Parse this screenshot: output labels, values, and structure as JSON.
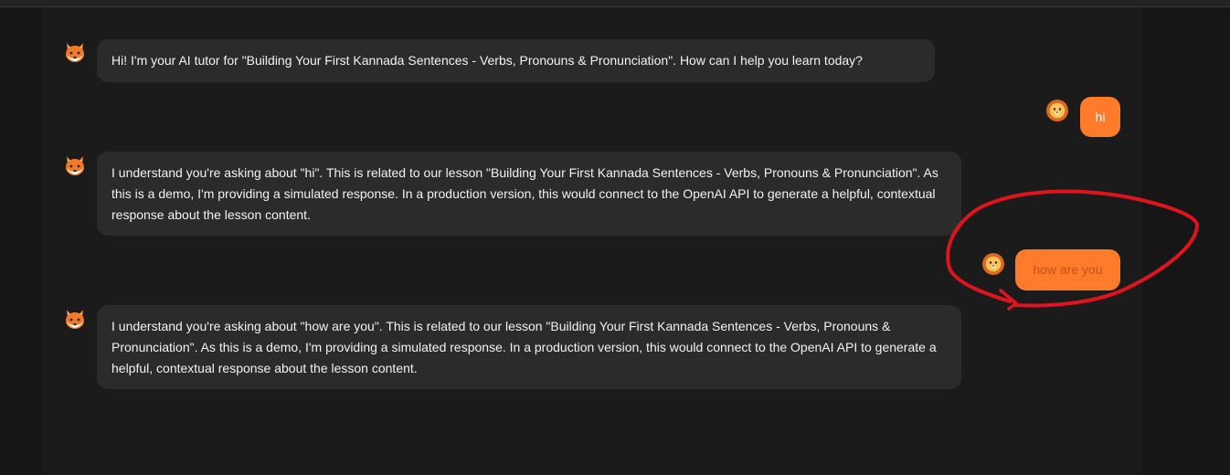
{
  "messages": [
    {
      "role": "assistant",
      "avatar_icon": "fox-icon",
      "text": "Hi! I'm your AI tutor for \"Building Your First Kannada Sentences - Verbs, Pronouns & Pronunciation\". How can I help you learn today?"
    },
    {
      "role": "user",
      "avatar_icon": "lion-icon",
      "text": "hi"
    },
    {
      "role": "assistant",
      "avatar_icon": "fox-icon",
      "text": "I understand you're asking about \"hi\". This is related to our lesson \"Building Your First Kannada Sentences - Verbs, Pronouns & Pronunciation\". As this is a demo, I'm providing a simulated response. In a production version, this would connect to the OpenAI API to generate a helpful, contextual response about the lesson content."
    },
    {
      "role": "user",
      "avatar_icon": "lion-icon",
      "text": "how are you"
    },
    {
      "role": "assistant",
      "avatar_icon": "fox-icon",
      "text": "I understand you're asking about \"how are you\". This is related to our lesson \"Building Your First Kannada Sentences - Verbs, Pronouns & Pronunciation\". As this is a demo, I'm providing a simulated response. In a production version, this would connect to the OpenAI API to generate a helpful, contextual response about the lesson content."
    }
  ],
  "colors": {
    "background": "#161616",
    "panel": "#1b1b1b",
    "ai_bubble": "#2b2b2b",
    "user_bubble": "#fd7b2a",
    "user_text_plain": "#ffffff",
    "user_text_highlighted": "#c4531a",
    "annotation": "#e0141e"
  }
}
